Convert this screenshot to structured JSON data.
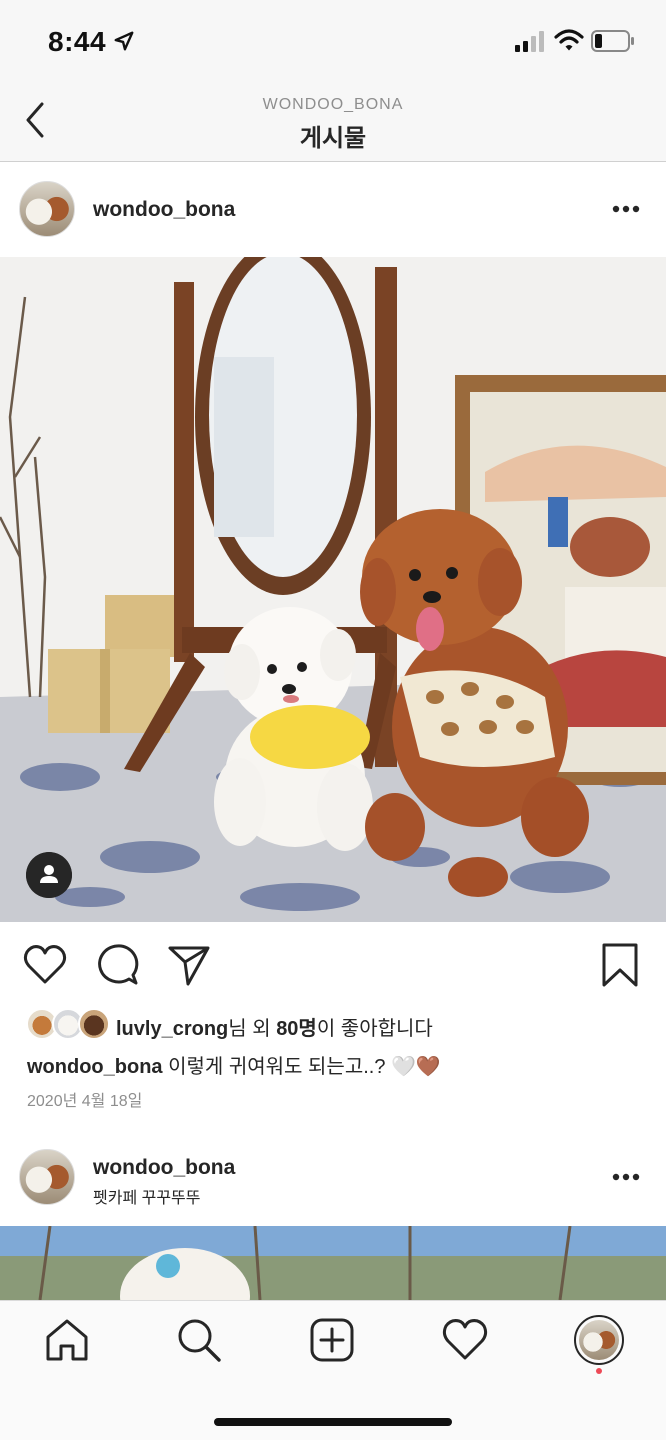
{
  "status_bar": {
    "time": "8:44",
    "icons": [
      "location-arrow-icon",
      "cellular-signal-icon",
      "wifi-icon",
      "battery-icon"
    ]
  },
  "header": {
    "subtitle": "WONDOO_BONA",
    "title": "게시물",
    "back_icon": "chevron-left-icon"
  },
  "post": {
    "username": "wondoo_bona",
    "more_icon": "more-horizontal-icon",
    "actions": [
      "heart-icon",
      "comment-icon",
      "send-icon",
      "bookmark-icon"
    ],
    "likes": {
      "liker": "luvly_crong",
      "suffix1": "님 외 ",
      "count": "80명",
      "suffix2": "이 좋아합니다"
    },
    "caption": {
      "username": "wondoo_bona",
      "text": " 이렇게 귀여워도 되는고..? 🤍🤎"
    },
    "date": "2020년 4월 18일"
  },
  "post2": {
    "username": "wondoo_bona",
    "location": "펫카페 꾸꾸뚜뚜",
    "more_icon": "more-horizontal-icon"
  },
  "tab_bar": {
    "items": [
      "home-icon",
      "search-icon",
      "add-post-icon",
      "activity-heart-icon",
      "profile-avatar"
    ]
  },
  "colors": {
    "text": "#262626",
    "secondary": "#8e8e8e",
    "notification": "#ed4956",
    "bar_bg": "#f7f7f7"
  }
}
